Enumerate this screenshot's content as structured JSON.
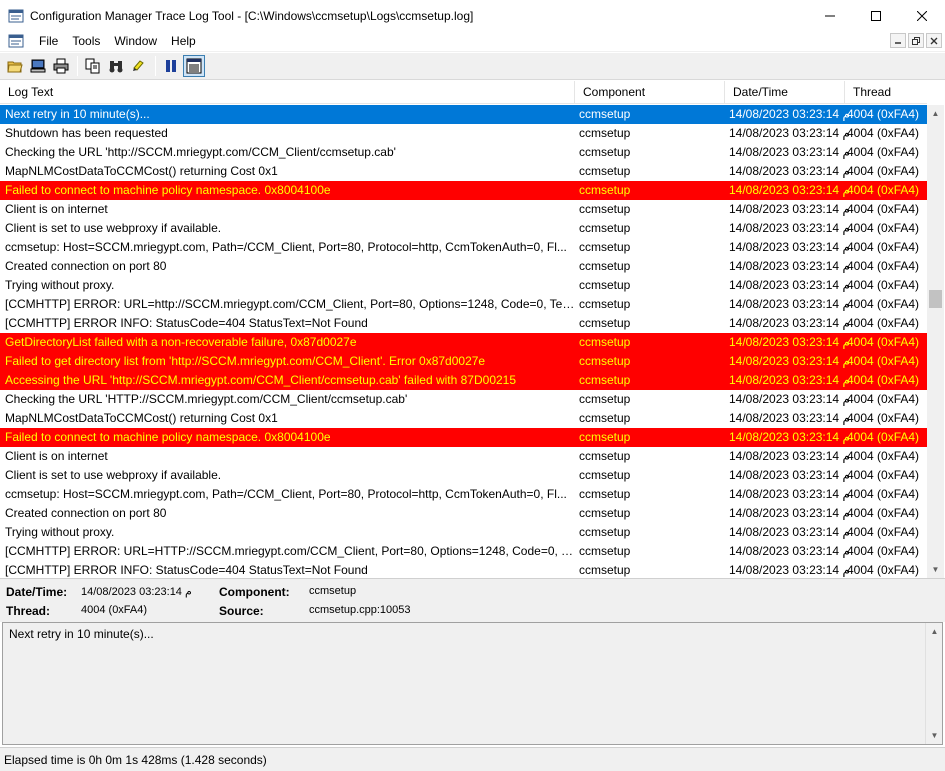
{
  "window": {
    "title": "Configuration Manager Trace Log Tool - [C:\\Windows\\ccmsetup\\Logs\\ccmsetup.log]"
  },
  "menu": {
    "items": [
      "File",
      "Tools",
      "Window",
      "Help"
    ]
  },
  "toolbar": {
    "icons": [
      "open-folder-icon",
      "computer-icon",
      "print-icon",
      "copy-icon",
      "find-icon",
      "highlight-icon",
      "pause-icon",
      "preview-pane-icon"
    ]
  },
  "columns": [
    "Log Text",
    "Component",
    "Date/Time",
    "Thread"
  ],
  "rows": [
    {
      "text": "Next retry in 10 minute(s)...",
      "component": "ccmsetup",
      "datetime": "14/08/2023 03:23:14 م",
      "thread": "4004 (0xFA4)",
      "type": "selected"
    },
    {
      "text": "Shutdown has been requested",
      "component": "ccmsetup",
      "datetime": "14/08/2023 03:23:14 م",
      "thread": "4004 (0xFA4)",
      "type": "normal"
    },
    {
      "text": "Checking the URL 'http://SCCM.mriegypt.com/CCM_Client/ccmsetup.cab'",
      "component": "ccmsetup",
      "datetime": "14/08/2023 03:23:14 م",
      "thread": "4004 (0xFA4)",
      "type": "normal"
    },
    {
      "text": "MapNLMCostDataToCCMCost() returning Cost 0x1",
      "component": "ccmsetup",
      "datetime": "14/08/2023 03:23:14 م",
      "thread": "4004 (0xFA4)",
      "type": "normal"
    },
    {
      "text": "Failed to connect to machine policy namespace. 0x8004100e",
      "component": "ccmsetup",
      "datetime": "14/08/2023 03:23:14 م",
      "thread": "4004 (0xFA4)",
      "type": "error"
    },
    {
      "text": "Client is on internet",
      "component": "ccmsetup",
      "datetime": "14/08/2023 03:23:14 م",
      "thread": "4004 (0xFA4)",
      "type": "normal"
    },
    {
      "text": "Client is set to use webproxy if available.",
      "component": "ccmsetup",
      "datetime": "14/08/2023 03:23:14 م",
      "thread": "4004 (0xFA4)",
      "type": "normal"
    },
    {
      "text": "ccmsetup: Host=SCCM.mriegypt.com, Path=/CCM_Client, Port=80, Protocol=http, CcmTokenAuth=0, Fl...",
      "component": "ccmsetup",
      "datetime": "14/08/2023 03:23:14 م",
      "thread": "4004 (0xFA4)",
      "type": "normal"
    },
    {
      "text": "Created connection on port 80",
      "component": "ccmsetup",
      "datetime": "14/08/2023 03:23:14 م",
      "thread": "4004 (0xFA4)",
      "type": "normal"
    },
    {
      "text": "Trying without proxy.",
      "component": "ccmsetup",
      "datetime": "14/08/2023 03:23:14 م",
      "thread": "4004 (0xFA4)",
      "type": "normal"
    },
    {
      "text": "[CCMHTTP] ERROR: URL=http://SCCM.mriegypt.com/CCM_Client, Port=80, Options=1248, Code=0, Text...",
      "component": "ccmsetup",
      "datetime": "14/08/2023 03:23:14 م",
      "thread": "4004 (0xFA4)",
      "type": "normal"
    },
    {
      "text": "[CCMHTTP] ERROR INFO: StatusCode=404 StatusText=Not Found",
      "component": "ccmsetup",
      "datetime": "14/08/2023 03:23:14 م",
      "thread": "4004 (0xFA4)",
      "type": "normal"
    },
    {
      "text": "GetDirectoryList failed with a non-recoverable failure, 0x87d0027e",
      "component": "ccmsetup",
      "datetime": "14/08/2023 03:23:14 م",
      "thread": "4004 (0xFA4)",
      "type": "error"
    },
    {
      "text": "Failed to get directory list from 'http://SCCM.mriegypt.com/CCM_Client'. Error 0x87d0027e",
      "component": "ccmsetup",
      "datetime": "14/08/2023 03:23:14 م",
      "thread": "4004 (0xFA4)",
      "type": "error"
    },
    {
      "text": "Accessing the URL 'http://SCCM.mriegypt.com/CCM_Client/ccmsetup.cab' failed with 87D00215",
      "component": "ccmsetup",
      "datetime": "14/08/2023 03:23:14 م",
      "thread": "4004 (0xFA4)",
      "type": "error"
    },
    {
      "text": "Checking the URL 'HTTP://SCCM.mriegypt.com/CCM_Client/ccmsetup.cab'",
      "component": "ccmsetup",
      "datetime": "14/08/2023 03:23:14 م",
      "thread": "4004 (0xFA4)",
      "type": "normal"
    },
    {
      "text": "MapNLMCostDataToCCMCost() returning Cost 0x1",
      "component": "ccmsetup",
      "datetime": "14/08/2023 03:23:14 م",
      "thread": "4004 (0xFA4)",
      "type": "normal"
    },
    {
      "text": "Failed to connect to machine policy namespace. 0x8004100e",
      "component": "ccmsetup",
      "datetime": "14/08/2023 03:23:14 م",
      "thread": "4004 (0xFA4)",
      "type": "error"
    },
    {
      "text": "Client is on internet",
      "component": "ccmsetup",
      "datetime": "14/08/2023 03:23:14 م",
      "thread": "4004 (0xFA4)",
      "type": "normal"
    },
    {
      "text": "Client is set to use webproxy if available.",
      "component": "ccmsetup",
      "datetime": "14/08/2023 03:23:14 م",
      "thread": "4004 (0xFA4)",
      "type": "normal"
    },
    {
      "text": "ccmsetup: Host=SCCM.mriegypt.com, Path=/CCM_Client, Port=80, Protocol=http, CcmTokenAuth=0, Fl...",
      "component": "ccmsetup",
      "datetime": "14/08/2023 03:23:14 م",
      "thread": "4004 (0xFA4)",
      "type": "normal"
    },
    {
      "text": "Created connection on port 80",
      "component": "ccmsetup",
      "datetime": "14/08/2023 03:23:14 م",
      "thread": "4004 (0xFA4)",
      "type": "normal"
    },
    {
      "text": "Trying without proxy.",
      "component": "ccmsetup",
      "datetime": "14/08/2023 03:23:14 م",
      "thread": "4004 (0xFA4)",
      "type": "normal"
    },
    {
      "text": "[CCMHTTP] ERROR: URL=HTTP://SCCM.mriegypt.com/CCM_Client, Port=80, Options=1248, Code=0, Tex...",
      "component": "ccmsetup",
      "datetime": "14/08/2023 03:23:14 م",
      "thread": "4004 (0xFA4)",
      "type": "normal"
    },
    {
      "text": "[CCMHTTP] ERROR INFO: StatusCode=404 StatusText=Not Found",
      "component": "ccmsetup",
      "datetime": "14/08/2023 03:23:14 م",
      "thread": "4004 (0xFA4)",
      "type": "normal"
    }
  ],
  "details": {
    "datetime_label": "Date/Time:",
    "datetime_value": "14/08/2023 03:23:14 م",
    "component_label": "Component:",
    "component_value": "ccmsetup",
    "thread_label": "Thread:",
    "thread_value": "4004 (0xFA4)",
    "source_label": "Source:",
    "source_value": "ccmsetup.cpp:10053"
  },
  "message": {
    "text": "Next retry in 10 minute(s)..."
  },
  "status": {
    "text": "Elapsed time is 0h 0m 1s 428ms (1.428 seconds)"
  },
  "colors": {
    "selected_bg": "#0078d7",
    "error_bg": "#ff0000",
    "error_fg": "#ffff00"
  }
}
